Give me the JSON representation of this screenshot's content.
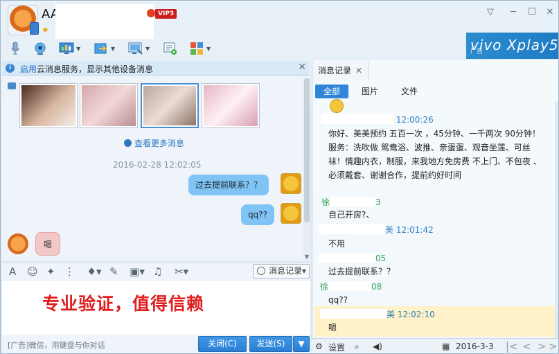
{
  "header": {
    "title": "AA",
    "vip_badge": "VIP3",
    "window_controls": [
      "▽",
      "─",
      "☐",
      "✕"
    ]
  },
  "toolbar": {
    "items": [
      "mic-icon",
      "camera-icon",
      "screen-share-icon",
      "file-transfer-icon",
      "remote-desktop-icon",
      "add-app-icon",
      "apps-icon"
    ]
  },
  "ad_banner": {
    "brand": "vivo Xplay5",
    "tag": "广告"
  },
  "notice": {
    "link": "启用",
    "text": "云消息服务，显示其他设备消息",
    "close": "✕"
  },
  "chat": {
    "view_more": "查看更多消息",
    "timestamp": "2016-02-28 12:02:05",
    "messages_out": [
      "过去提前联系？？",
      "qq??"
    ],
    "message_in": "嗯"
  },
  "input_toolbar": {
    "history_button": "消息记录"
  },
  "compose": {
    "watermark": "专业验证，值得信赖",
    "footer_ad": "[广告]微信，用键盘与你对话",
    "close_button": "关闭(C)",
    "send_button": "发送(S)"
  },
  "history": {
    "tab_label": "消息记录",
    "filters": [
      "全部",
      "图片",
      "文件"
    ],
    "entries": [
      {
        "time": "12:00:26",
        "text": "你好、美美预约 五百一次 ，45分钟、一千两次 90分钟！服务：洗吹做 鸳鸯浴、波推、亲蛋蛋、观音坐莲、可丝袜！情趣内衣，制服，来我地方免房费 不上门、不包夜 、必须戴套、谢谢合作，提前约好时间"
      },
      {
        "time": "3",
        "name": "徐",
        "text": "自己开房?、"
      },
      {
        "time": "12:01:42",
        "name": "美",
        "text": "不用"
      },
      {
        "time": "05",
        "text": "过去提前联系？？"
      },
      {
        "time": "08",
        "name": "徐",
        "text": "qq??"
      },
      {
        "time": "12:02:10",
        "name": "美",
        "text": "嗯"
      }
    ],
    "footer": {
      "settings": "设置",
      "date": "2016-3-3"
    }
  },
  "colors": {
    "accent": "#2f86d8",
    "bubble": "#7fc4f4",
    "watermark": "#e01c1c"
  }
}
